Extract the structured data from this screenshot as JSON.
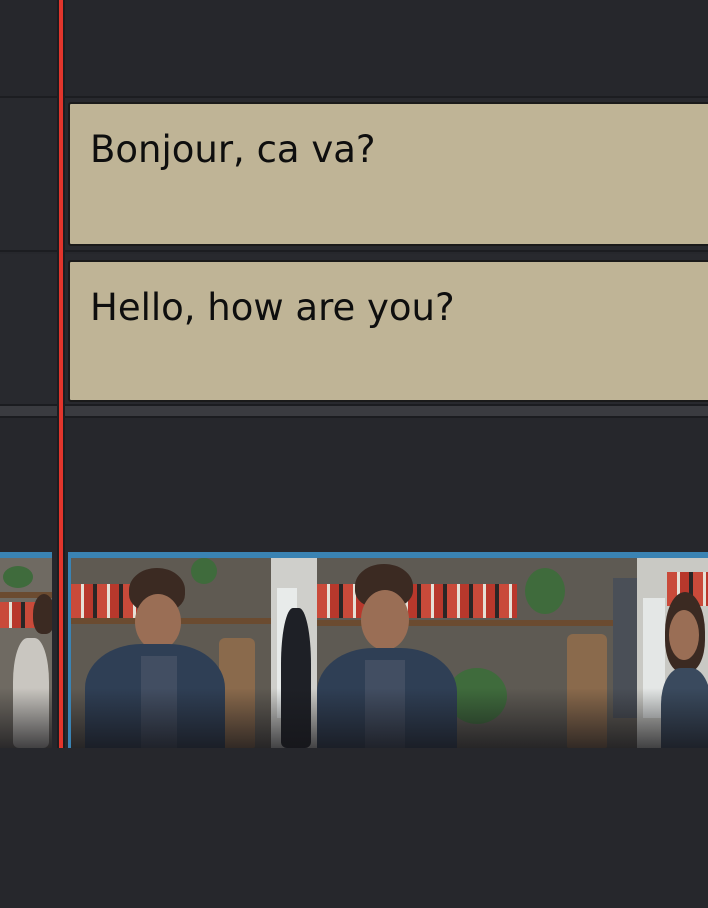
{
  "subtitles": {
    "track1": {
      "text": "Bonjour, ca va?"
    },
    "track2": {
      "text": "Hello, how are you?"
    }
  },
  "colors": {
    "playhead": "#e2352c",
    "subtitle_clip": "#bfb496",
    "video_clip_border": "#3a83b3",
    "background": "#26272c"
  },
  "icons": [
    "playhead-marker"
  ]
}
